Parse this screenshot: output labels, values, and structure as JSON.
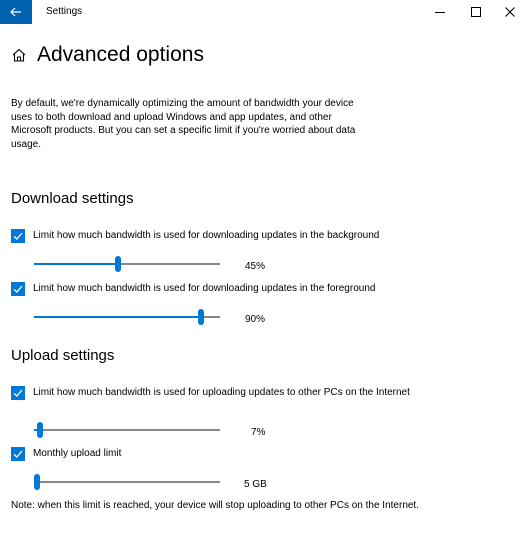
{
  "window": {
    "title": "Settings"
  },
  "page": {
    "title": "Advanced options",
    "description": "By default, we're dynamically optimizing the amount of bandwidth your device uses to both download and upload Windows and app updates, and other Microsoft products. But you can set a specific limit if you're worried about data usage."
  },
  "download": {
    "title": "Download settings",
    "background": {
      "checked": true,
      "label": "Limit how much bandwidth is used for downloading updates in the background",
      "value_text": "45%",
      "level": 0.45
    },
    "foreground": {
      "checked": true,
      "label": "Limit how much bandwidth is used for downloading updates in the foreground",
      "value_text": "90%",
      "level": 0.9
    }
  },
  "upload": {
    "title": "Upload settings",
    "limit": {
      "checked": true,
      "label": "Limit how much bandwidth is used for uploading updates to other PCs on the Internet",
      "value_text": "7%",
      "level": 0.03
    },
    "monthly": {
      "checked": true,
      "label": "Monthly upload limit",
      "value_text": "5 GB",
      "level": 0.01
    }
  },
  "note": "Note: when this limit is reached, your device will stop uploading to other PCs on the Internet.",
  "colors": {
    "accent": "#0078d7",
    "titlebar_accent": "#0063b1",
    "track": "#868686"
  },
  "icons": {
    "back": "back-arrow-icon",
    "home": "home-icon",
    "minimize": "minimize-icon",
    "maximize": "maximize-icon",
    "close": "close-icon",
    "check": "checkmark-icon"
  }
}
